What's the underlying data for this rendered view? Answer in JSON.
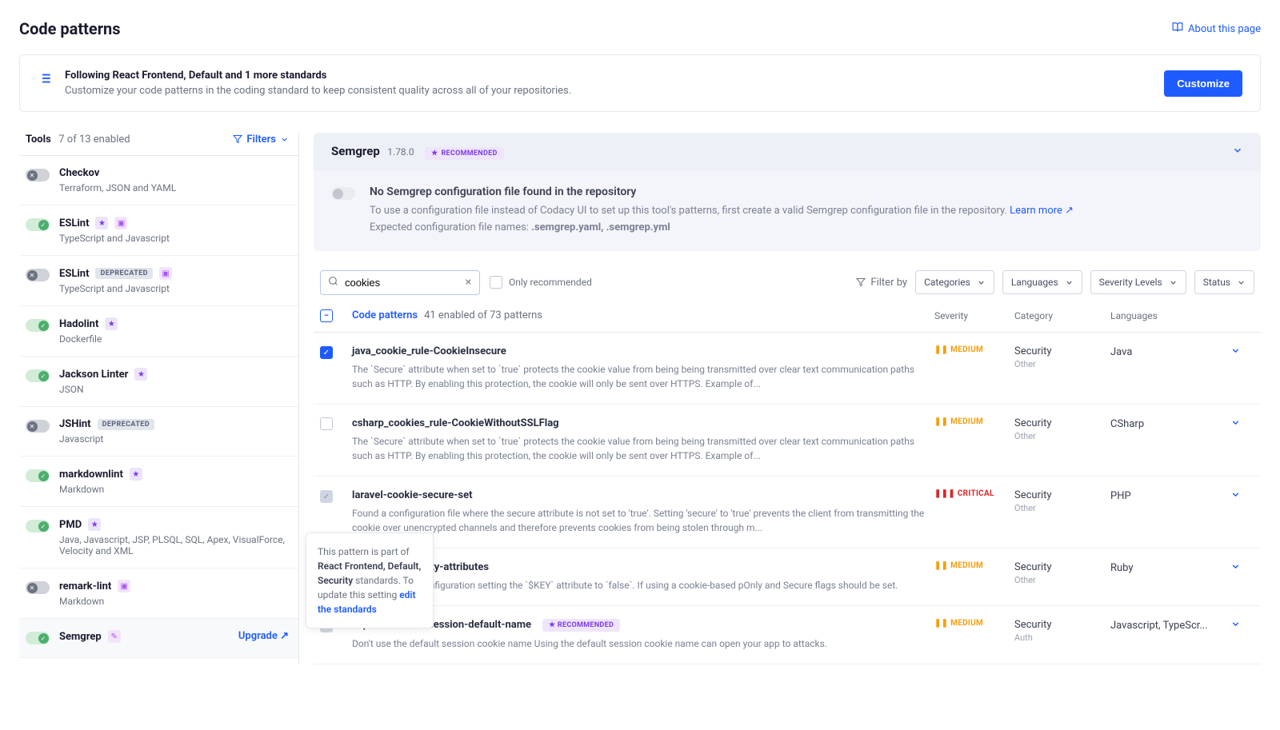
{
  "header": {
    "title": "Code patterns",
    "about": "About this page"
  },
  "banner": {
    "title": "Following React Frontend, Default and 1 more standards",
    "subtitle": "Customize your code patterns in the coding standard to keep consistent quality across all of your repositories.",
    "button": "Customize"
  },
  "sidebar": {
    "title": "Tools",
    "count": "7 of 13 enabled",
    "filters": "Filters",
    "upgrade": "Upgrade",
    "tools": [
      {
        "name": "Checkov",
        "langs": "Terraform, JSON and YAML",
        "enabled": false,
        "deprecated": false,
        "star": false,
        "config": false
      },
      {
        "name": "ESLint",
        "langs": "TypeScript and Javascript",
        "enabled": true,
        "deprecated": false,
        "star": true,
        "config": true
      },
      {
        "name": "ESLint",
        "langs": "TypeScript and Javascript",
        "enabled": false,
        "deprecated": true,
        "star": false,
        "config": true
      },
      {
        "name": "Hadolint",
        "langs": "Dockerfile",
        "enabled": true,
        "deprecated": false,
        "star": true,
        "config": false
      },
      {
        "name": "Jackson Linter",
        "langs": "JSON",
        "enabled": true,
        "deprecated": false,
        "star": true,
        "config": false
      },
      {
        "name": "JSHint",
        "langs": "Javascript",
        "enabled": false,
        "deprecated": true,
        "star": false,
        "config": false
      },
      {
        "name": "markdownlint",
        "langs": "Markdown",
        "enabled": true,
        "deprecated": false,
        "star": true,
        "config": false
      },
      {
        "name": "PMD",
        "langs": "Java, Javascript, JSP, PLSQL, SQL, Apex, VisualForce, Velocity and XML",
        "enabled": true,
        "deprecated": false,
        "star": true,
        "config": false
      },
      {
        "name": "remark-lint",
        "langs": "Markdown",
        "enabled": false,
        "deprecated": false,
        "star": false,
        "config": true
      },
      {
        "name": "Semgrep",
        "langs": "",
        "enabled": true,
        "deprecated": false,
        "star": false,
        "config": false,
        "selected": true,
        "hasUpgrade": true
      }
    ]
  },
  "content": {
    "tool_name": "Semgrep",
    "tool_version": "1.78.0",
    "recommended_badge": "RECOMMENDED",
    "deprecated_badge": "DEPRECATED",
    "config_notice": {
      "title": "No Semgrep configuration file found in the repository",
      "text_before": "To use a configuration file instead of Codacy UI to set up this tool's patterns, first create a valid Semgrep configuration file in the repository. ",
      "learn_more": "Learn more",
      "expected": "Expected configuration file names: ",
      "files": ".semgrep.yaml, .semgrep.yml"
    },
    "filters": {
      "search_value": "cookies",
      "only_recommended": "Only recommended",
      "filter_by": "Filter by",
      "categories": "Categories",
      "languages": "Languages",
      "severity": "Severity Levels",
      "status": "Status"
    },
    "table": {
      "col_patterns": "Code patterns",
      "col_count": "41 enabled of 73 patterns",
      "col_severity": "Severity",
      "col_category": "Category",
      "col_languages": "Languages",
      "rows": [
        {
          "name": "java_cookie_rule-CookieInsecure",
          "desc": "The `Secure` attribute when set to `true` protects the cookie value from being being transmitted over clear text communication paths such as HTTP. By enabling this protection, the cookie will only be sent over HTTPS. Example of...",
          "checked": true,
          "muted": false,
          "severity": "MEDIUM",
          "category": "Security",
          "subcategory": "Other",
          "langs": "Java",
          "recommended": false
        },
        {
          "name": "csharp_cookies_rule-CookieWithoutSSLFlag",
          "desc": "The `Secure` attribute when set to `true` protects the cookie value from being being transmitted over clear text communication paths such as HTTP. By enabling this protection, the cookie will only be sent over HTTPS. Example of...",
          "checked": false,
          "muted": false,
          "severity": "MEDIUM",
          "category": "Security",
          "subcategory": "Other",
          "langs": "CSharp",
          "recommended": false
        },
        {
          "name": "laravel-cookie-secure-set",
          "desc": "Found a configuration file where the secure attribute is not set to 'true'. Setting 'secure' to 'true' prevents the client from transmitting the cookie over unencrypted channels and therefore prevents cookies from being stolen through m...",
          "checked": true,
          "muted": true,
          "severity": "CRITICAL",
          "category": "Security",
          "subcategory": "Other",
          "langs": "PHP",
          "recommended": false
        },
        {
          "name": "e-session-security-attributes",
          "desc": "_store` session configuration setting the `$KEY` attribute to `false`. If using a cookie-based pOnly and Secure flags should be set.",
          "checked": true,
          "muted": true,
          "severity": "MEDIUM",
          "category": "Security",
          "subcategory": "Other",
          "langs": "Ruby",
          "recommended": false
        },
        {
          "name": "express-cookie-session-default-name",
          "desc": "Don't use the default session cookie name Using the default session cookie name can open your app to attacks.",
          "checked": true,
          "muted": true,
          "severity": "MEDIUM",
          "category": "Security",
          "subcategory": "Auth",
          "langs": "Javascript, TypeScr...",
          "recommended": true
        }
      ]
    },
    "tooltip": {
      "prefix": "This pattern is part of ",
      "standards": "React Frontend, Default, Security",
      "middle": " standards. To update this setting ",
      "link": "edit the standards"
    }
  }
}
